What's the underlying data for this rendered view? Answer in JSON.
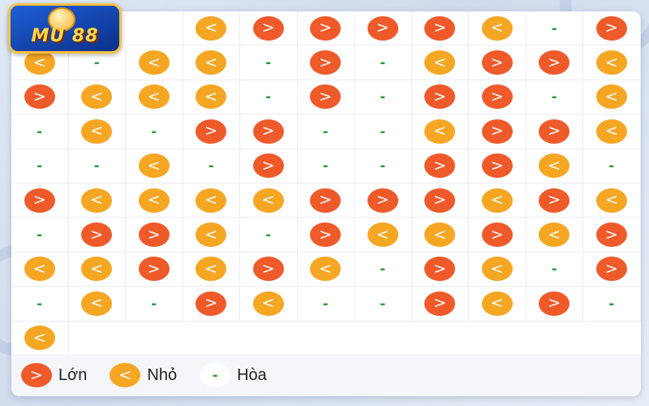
{
  "brand": {
    "logo_text": "MU 88"
  },
  "symbols": {
    "lon": ">",
    "nho": "<",
    "hoa": "-"
  },
  "grid": {
    "rows": [
      [
        "",
        "N",
        "L",
        "L",
        "L",
        "L",
        "N",
        "H",
        "L"
      ],
      [
        "N",
        "H",
        "N",
        "N",
        "H",
        "L",
        "H",
        "N",
        "L",
        "L",
        "N"
      ],
      [
        "L",
        "N",
        "N",
        "N",
        "H",
        "L",
        "H",
        "L",
        "L",
        "H",
        "N"
      ],
      [
        "H",
        "N",
        "H",
        "L",
        "L",
        "H",
        "H",
        "N",
        "L",
        "L",
        "N"
      ],
      [
        "H",
        "H",
        "N",
        "H",
        "L",
        "H",
        "H",
        "L",
        "L",
        "N",
        "H"
      ],
      [
        "L",
        "N",
        "N",
        "N",
        "N",
        "L",
        "L",
        "L",
        "N",
        "L",
        "N"
      ],
      [
        "H",
        "L",
        "L",
        "N",
        "H",
        "L",
        "N",
        "N",
        "L",
        "N",
        "L"
      ],
      [
        "N",
        "N",
        "L",
        "N",
        "L",
        "N",
        "H",
        "L",
        "N",
        "H",
        "L"
      ],
      [
        "H",
        "N",
        "H",
        "L",
        "N",
        "H",
        "H",
        "L",
        "N",
        "L",
        "H"
      ],
      [
        "N"
      ]
    ]
  },
  "legend": {
    "lon": {
      "symbol": ">",
      "label": "Lớn",
      "color": "#ef5a2a"
    },
    "nho": {
      "symbol": "<",
      "label": "Nhỏ",
      "color": "#f5a623"
    },
    "hoa": {
      "symbol": "-",
      "label": "Hòa",
      "color": "#2a9d3a"
    }
  }
}
